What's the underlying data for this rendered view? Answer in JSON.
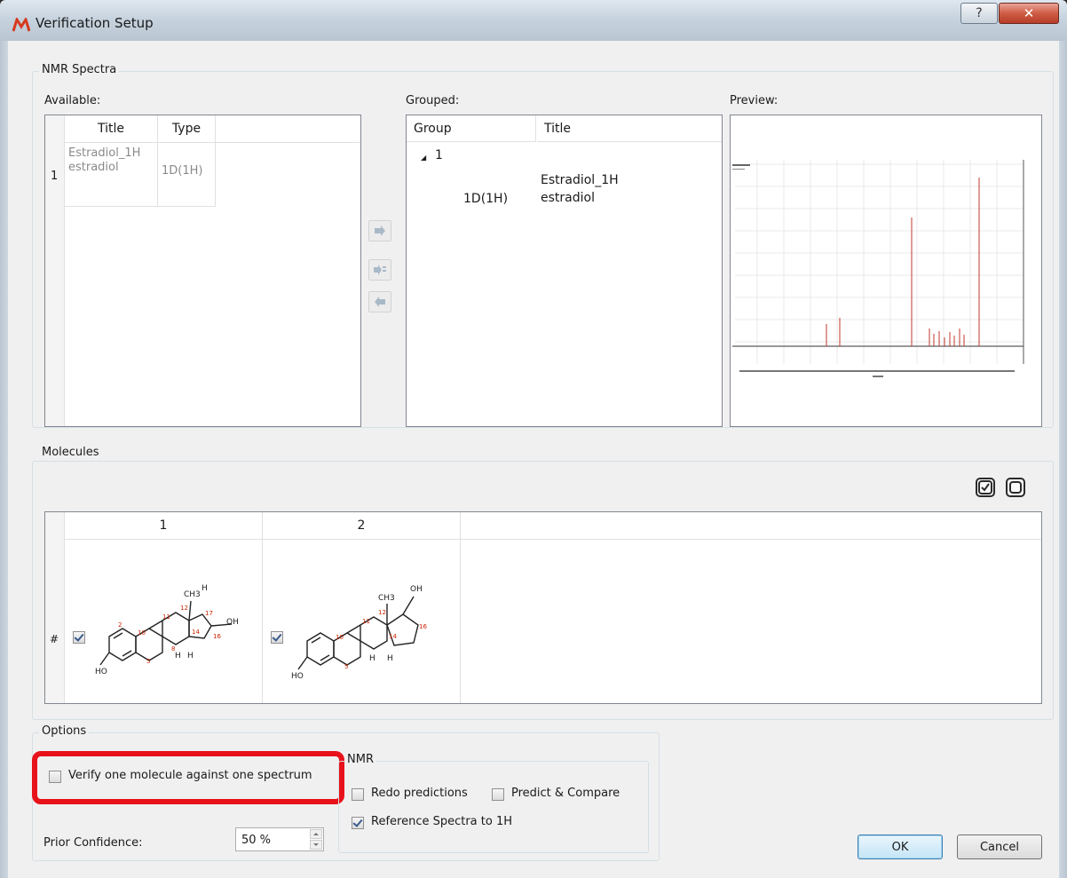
{
  "window": {
    "title": "Verification Setup",
    "help_glyph": "?",
    "close_glyph": "✕"
  },
  "nmr_spectra": {
    "group_label": "NMR Spectra",
    "available": {
      "label": "Available:",
      "columns": [
        "Title",
        "Type"
      ],
      "rows": [
        {
          "index": "1",
          "title_line1": "Estradiol_1H",
          "title_line2": "estradiol",
          "type": "1D(1H)"
        }
      ]
    },
    "grouped": {
      "label": "Grouped:",
      "columns": [
        "Group",
        "Title"
      ],
      "group_node": "1",
      "expander_glyph": "◢",
      "child": {
        "type": "1D(1H)",
        "title_line1": "Estradiol_1H",
        "title_line2": "estradiol"
      }
    },
    "preview": {
      "label": "Preview:"
    },
    "arrow_buttons": [
      "add-to-group",
      "add-as-new-group",
      "remove-from-group"
    ]
  },
  "molecules": {
    "group_label": "Molecules",
    "columns": [
      "1",
      "2"
    ],
    "row_header": "#",
    "items": [
      {
        "checked": true,
        "molecule": "estradiol-structure-1"
      },
      {
        "checked": true,
        "molecule": "estradiol-structure-2"
      }
    ]
  },
  "options": {
    "group_label": "Options",
    "verify_one": {
      "label": "Verify one molecule against one spectrum",
      "checked": false
    },
    "prior_confidence": {
      "label": "Prior Confidence:",
      "value": "50 %"
    },
    "nmr": {
      "group_label": "NMR",
      "redo_predictions": {
        "label": "Redo predictions",
        "checked": false
      },
      "predict_compare": {
        "label": "Predict & Compare",
        "checked": false
      },
      "reference_spectra": {
        "label": "Reference Spectra to 1H",
        "checked": true
      }
    }
  },
  "buttons": {
    "ok": "OK",
    "cancel": "Cancel"
  },
  "colors": {
    "highlight": "#e8121b",
    "spectrum": "#c0392b",
    "atom_labels": "#cc2200"
  }
}
